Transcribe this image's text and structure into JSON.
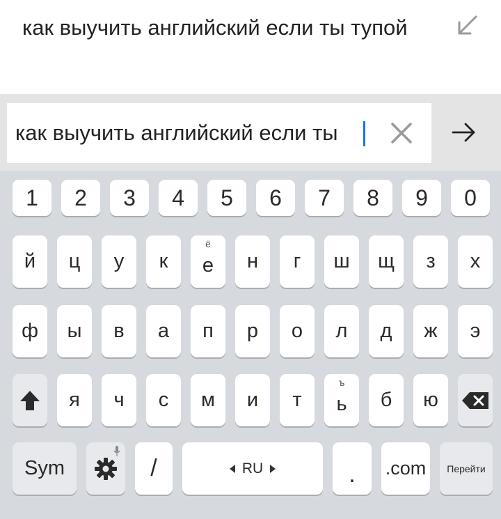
{
  "suggestion": {
    "text": "как выучить английский если ты тупой"
  },
  "search": {
    "value": "как выучить английский если ты"
  },
  "keyboard": {
    "numbers": [
      "1",
      "2",
      "3",
      "4",
      "5",
      "6",
      "7",
      "8",
      "9",
      "0"
    ],
    "row1": [
      "й",
      "ц",
      "у",
      "к",
      "е",
      "н",
      "г",
      "ш",
      "щ",
      "з",
      "х"
    ],
    "row1_alt": {
      "e": "ё"
    },
    "row2": [
      "ф",
      "ы",
      "в",
      "а",
      "п",
      "р",
      "о",
      "л",
      "д",
      "ж",
      "э"
    ],
    "row3": [
      "я",
      "ч",
      "с",
      "м",
      "и",
      "т",
      "ь",
      "б",
      "ю"
    ],
    "row3_alt": {
      "soft": "ъ"
    },
    "sym": "Sym",
    "slash": "/",
    "lang": "RU",
    "dot": ".",
    "com": ".com",
    "go": "Перейти"
  },
  "colors": {
    "caret": "#1a73e8",
    "keyboard_bg": "#d6d9de",
    "key_bg": "#ffffff"
  }
}
